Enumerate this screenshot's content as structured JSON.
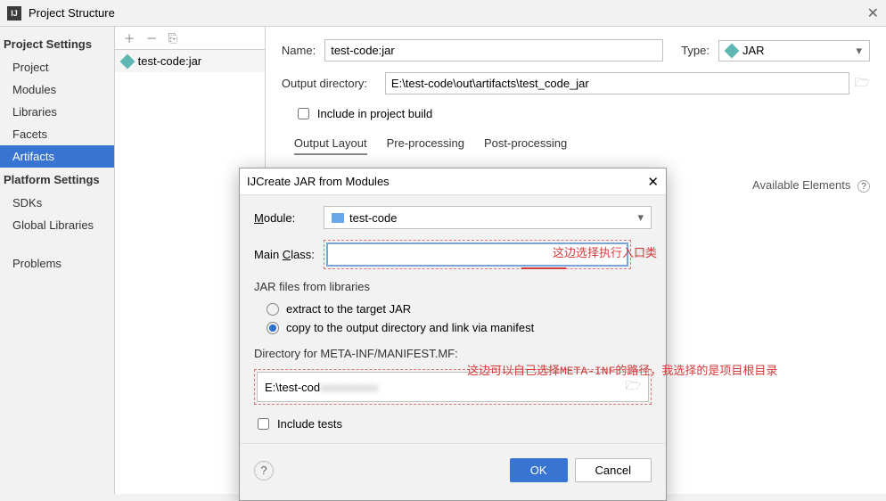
{
  "window": {
    "title": "Project Structure"
  },
  "sidebar": {
    "heading1": "Project Settings",
    "items1": [
      "Project",
      "Modules",
      "Libraries",
      "Facets",
      "Artifacts"
    ],
    "heading2": "Platform Settings",
    "items2": [
      "SDKs",
      "Global Libraries"
    ],
    "problems": "Problems"
  },
  "artifacts_list": {
    "item": "test-code:jar"
  },
  "form": {
    "name_label": "Name:",
    "name_value": "test-code:jar",
    "type_label": "Type:",
    "type_value": "JAR",
    "outdir_label": "Output directory:",
    "outdir_value": "E:\\test-code\\out\\artifacts\\test_code_jar",
    "include_build": "Include in project build",
    "tabs": {
      "t1": "Output Layout",
      "t2": "Pre-processing",
      "t3": "Post-processing"
    },
    "available": "Available Elements"
  },
  "dialog": {
    "title": "Create JAR from Modules",
    "module_label": "Module:",
    "module_value": "test-code",
    "mainclass_label": "Main Class:",
    "mainclass_value": "",
    "jar_section": "JAR files from libraries",
    "radio_extract": "extract to the target JAR",
    "radio_copy": "copy to the output directory and link via manifest",
    "dir_label": "Directory for META-INF/MANIFEST.MF:",
    "dir_value": "E:\\test-cod",
    "include_tests": "Include tests",
    "ok": "OK",
    "cancel": "Cancel"
  },
  "annotations": {
    "a1": "这边选择执行入口类",
    "a2": "这边可以自己选择META-INF的路径，我选择的是项目根目录"
  }
}
